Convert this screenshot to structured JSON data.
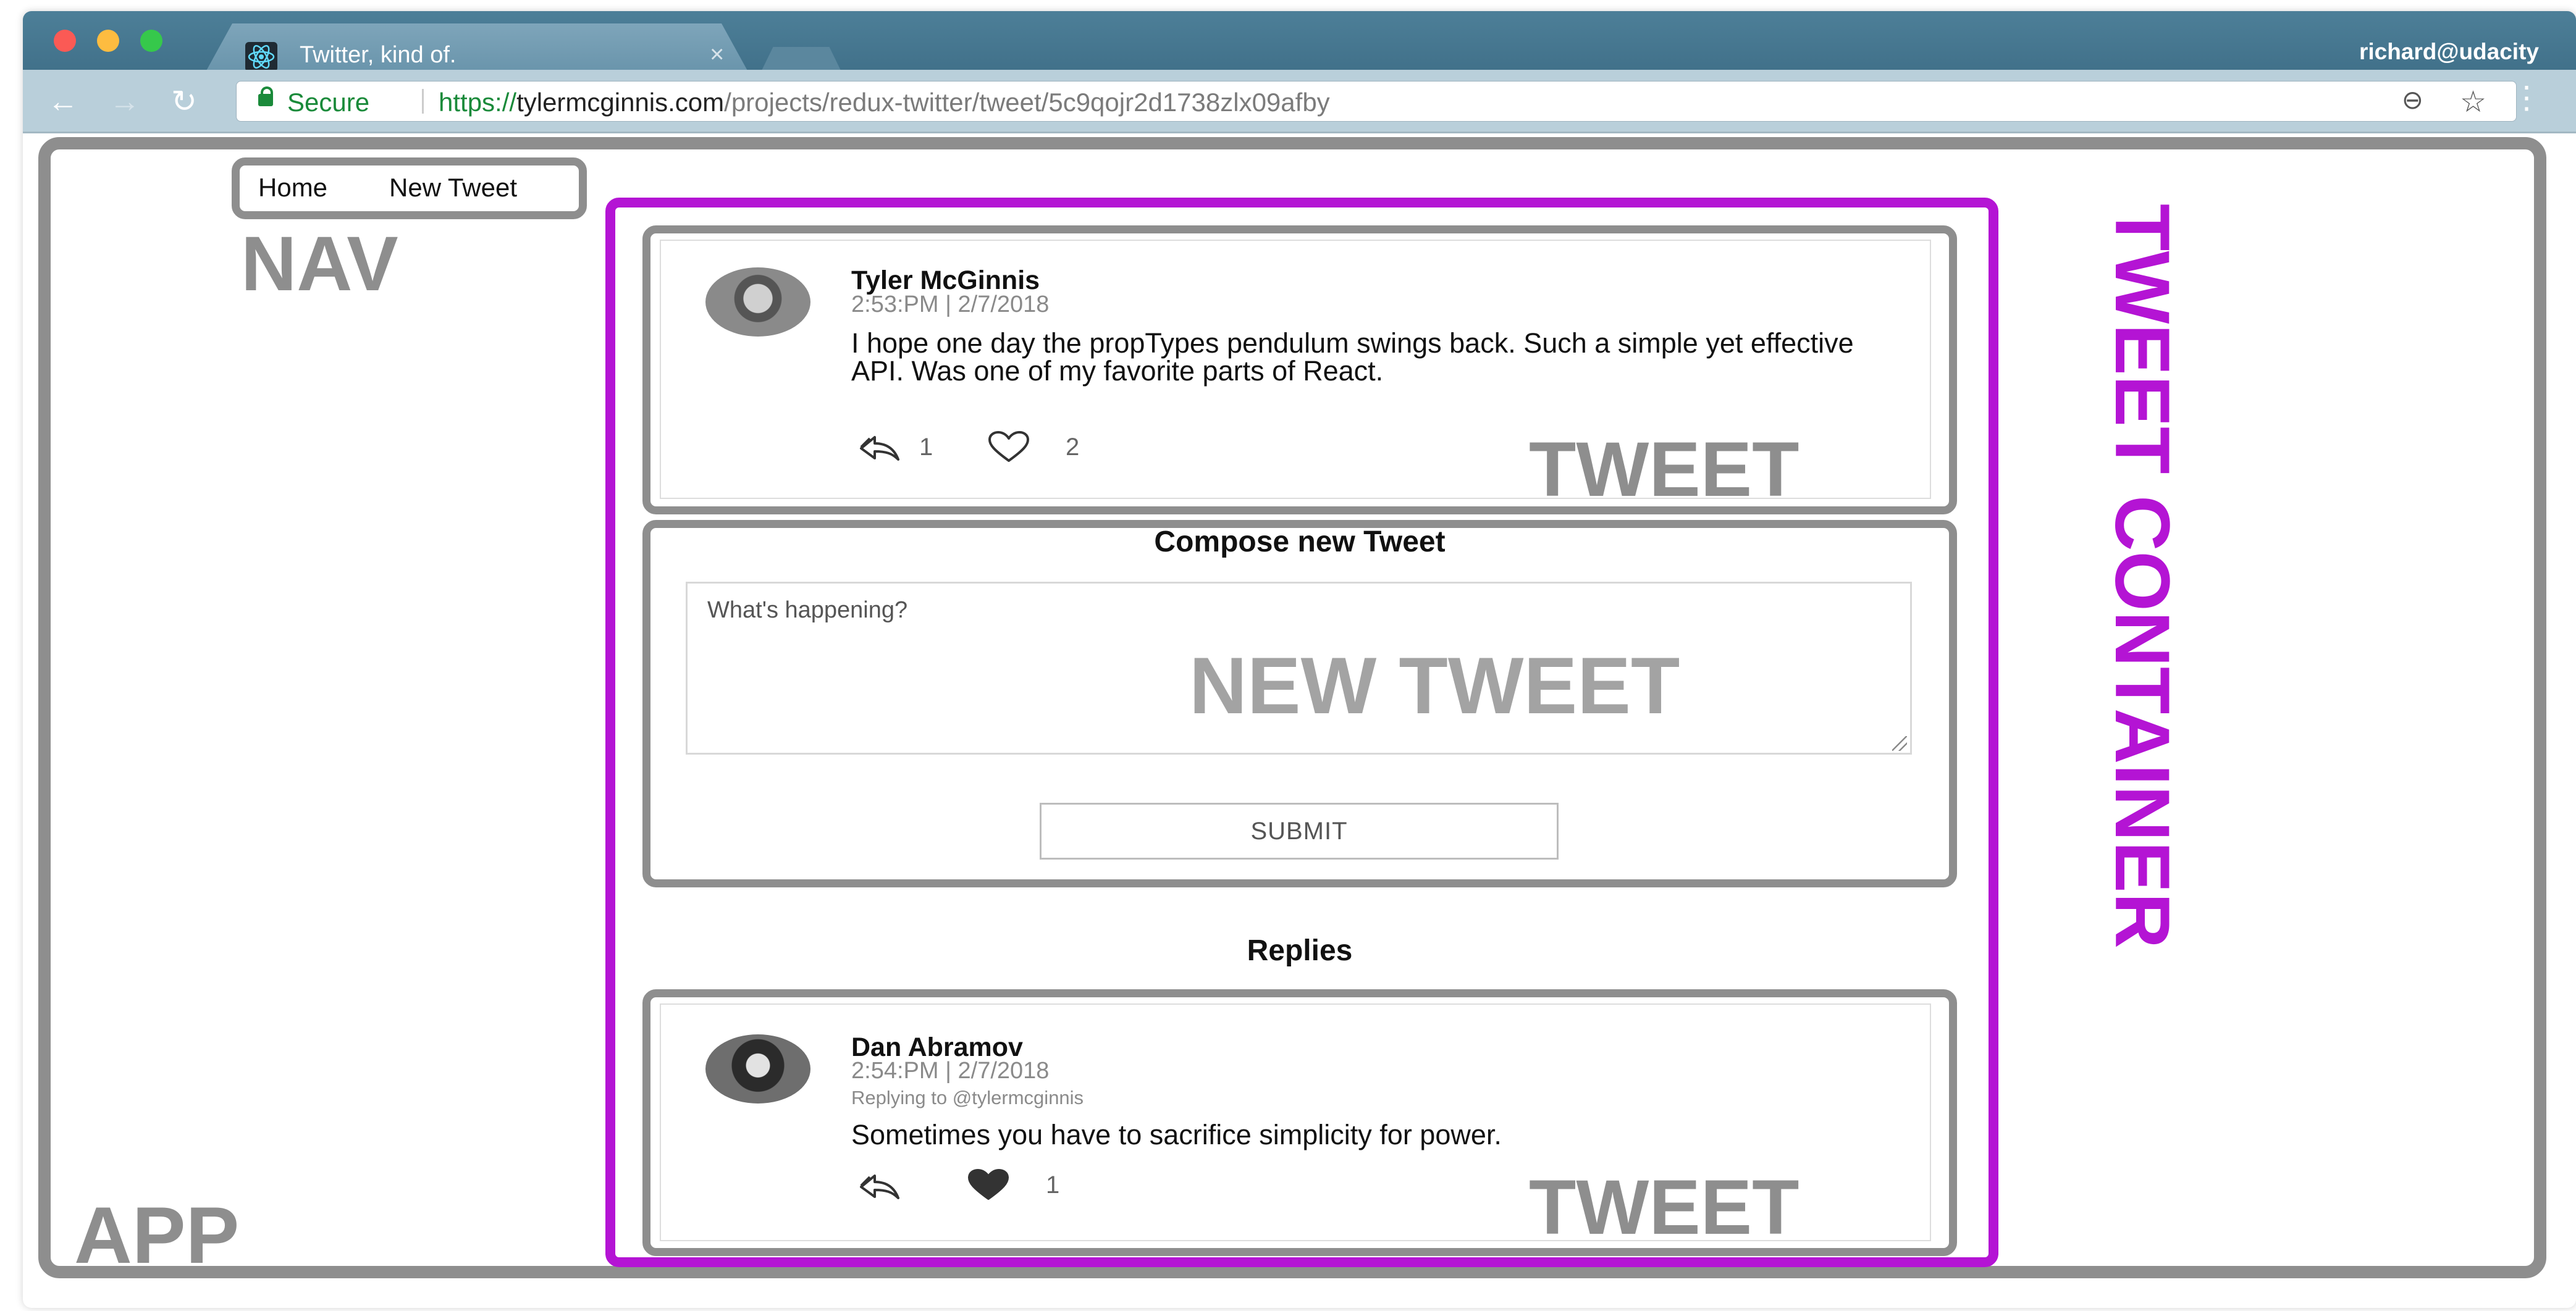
{
  "browser": {
    "tab_title": "Twitter, kind of.",
    "tab_close": "×",
    "account": "richard@udacity",
    "secure_label": "Secure",
    "url_scheme": "https://",
    "url_host": "tylermcginnis.com",
    "url_path": "/projects/redux-twitter/tweet/5c9qojr2d1738zlx09afby",
    "back_icon": "←",
    "forward_icon": "→",
    "reload_icon": "↻",
    "zoom_icon": "⊖",
    "star_icon": "☆",
    "menu_icon": "⋮"
  },
  "nav": {
    "home": "Home",
    "new_tweet": "New Tweet",
    "annotation": "NAV"
  },
  "annotations": {
    "app": "APP",
    "tweet_container": "TWEET CONTAINER",
    "tweet": "TWEET",
    "new_tweet": "NEW TWEET"
  },
  "tweet": {
    "author": "Tyler McGinnis",
    "date": "2:53:PM | 2/7/2018",
    "text": "I hope one day the propTypes pendulum swings back. Such a simple yet effective API. Was one of my favorite parts of React.",
    "replies": "1",
    "likes": "2"
  },
  "compose": {
    "title": "Compose new Tweet",
    "placeholder": "What's happening?",
    "submit": "SUBMIT"
  },
  "replies_title": "Replies",
  "replies": [
    {
      "author": "Dan Abramov",
      "date": "2:54:PM | 2/7/2018",
      "replying_to": "Replying to @tylermcginnis",
      "text": "Sometimes you have to sacrifice simplicity for power.",
      "likes": "1"
    }
  ],
  "colors": {
    "annotation_gray": "#8e8e8e",
    "container_purple": "#b414d4",
    "secure_green": "#1a8a3a",
    "titlebar": "#41718a"
  }
}
